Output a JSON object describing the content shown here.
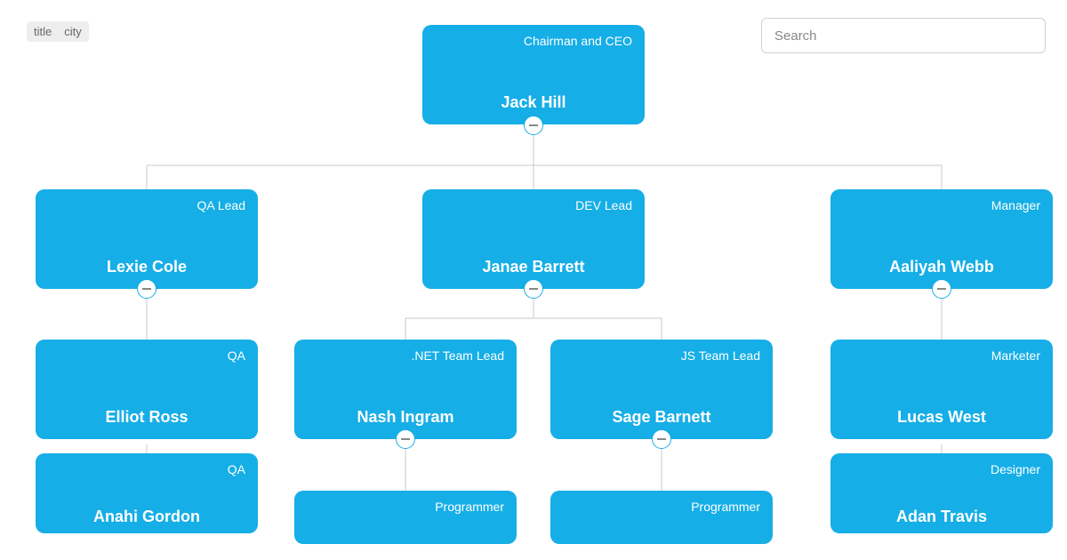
{
  "toolbar": {
    "items": [
      "title",
      "city"
    ]
  },
  "search": {
    "placeholder": "Search"
  },
  "accent_color": "#16aee6",
  "chart_data": {
    "type": "tree",
    "root": {
      "name": "Jack Hill",
      "title": "Chairman and CEO",
      "children": [
        {
          "name": "Lexie Cole",
          "title": "QA Lead",
          "children": [
            {
              "name": "Elliot Ross",
              "title": "QA"
            },
            {
              "name": "Anahi Gordon",
              "title": "QA"
            }
          ]
        },
        {
          "name": "Janae Barrett",
          "title": "DEV Lead",
          "children": [
            {
              "name": "Nash Ingram",
              "title": ".NET Team Lead",
              "children": [
                {
                  "name": "",
                  "title": "Programmer"
                }
              ]
            },
            {
              "name": "Sage Barnett",
              "title": "JS Team Lead",
              "children": [
                {
                  "name": "",
                  "title": "Programmer"
                }
              ]
            }
          ]
        },
        {
          "name": "Aaliyah Webb",
          "title": "Manager",
          "children": [
            {
              "name": "Lucas West",
              "title": "Marketer"
            },
            {
              "name": "Adan Travis",
              "title": "Designer"
            }
          ]
        }
      ]
    }
  }
}
